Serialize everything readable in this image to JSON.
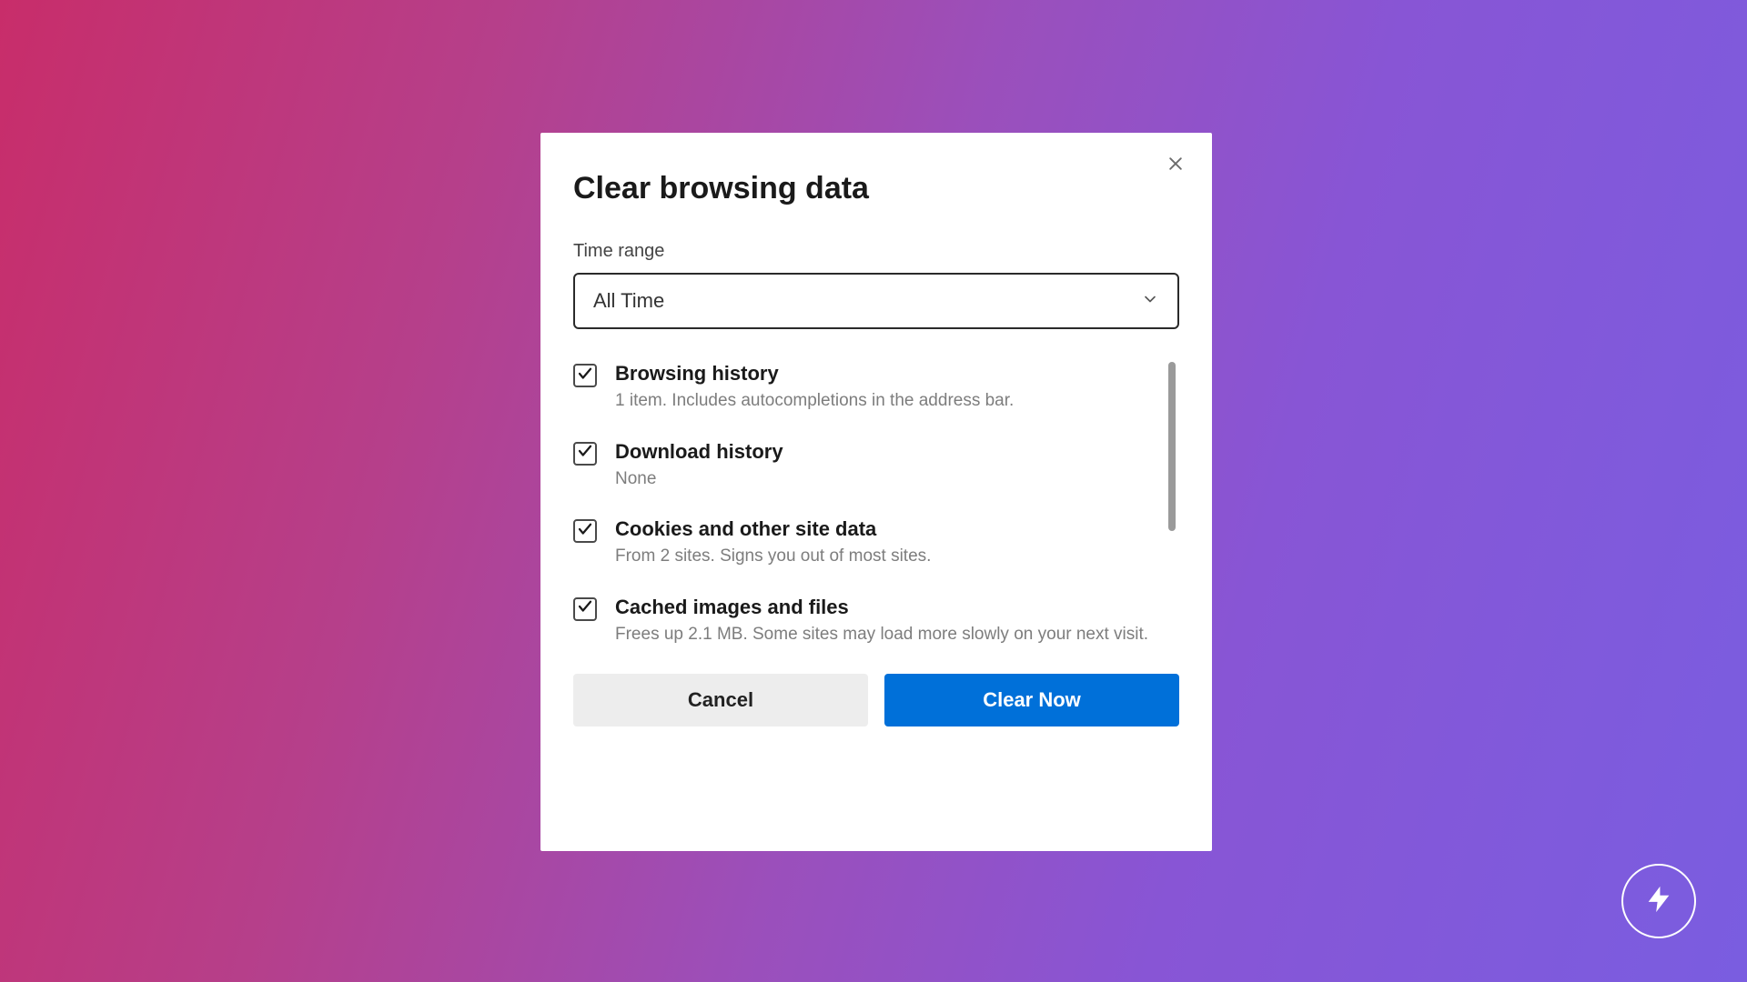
{
  "dialog": {
    "title": "Clear browsing data",
    "time_range_label": "Time range",
    "time_range_value": "All Time",
    "options": [
      {
        "title": "Browsing history",
        "desc": "1 item. Includes autocompletions in the address bar."
      },
      {
        "title": "Download history",
        "desc": "None"
      },
      {
        "title": "Cookies and other site data",
        "desc": "From 2 sites. Signs you out of most sites."
      },
      {
        "title": "Cached images and files",
        "desc": "Frees up 2.1 MB. Some sites may load more slowly on your next visit."
      }
    ],
    "cancel_label": "Cancel",
    "clear_label": "Clear Now"
  }
}
